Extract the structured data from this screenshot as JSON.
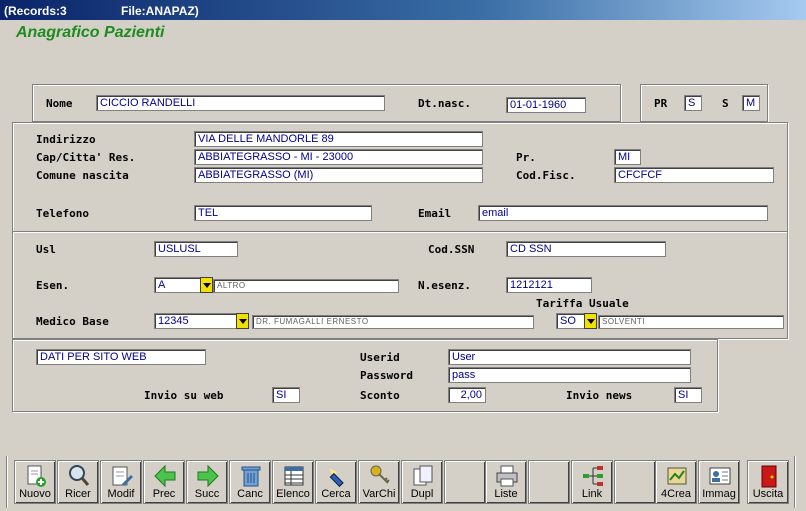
{
  "window": {
    "records": "(Records:3",
    "file": "File:ANAPAZ)"
  },
  "app_title": "Anagrafico Pazienti",
  "patient": {
    "nome_label": "Nome",
    "nome": "CICCIO RANDELLI",
    "dtnasc_label": "Dt.nasc.",
    "dtnasc": "01-01-1960",
    "pr_label": "PR",
    "pr": "S",
    "s_label": "S",
    "s": "M"
  },
  "address": {
    "indirizzo_label": "Indirizzo",
    "indirizzo": "VIA DELLE MANDORLE 89",
    "cap_label": "Cap/Citta' Res.",
    "cap": "ABBIATEGRASSO - MI - 23000",
    "prov_label": "Pr.",
    "prov": "MI",
    "comune_label": "Comune nascita",
    "comune": "ABBIATEGRASSO (MI)",
    "codfisc_label": "Cod.Fisc.",
    "codfisc": "CFCFCF",
    "telefono_label": "Telefono",
    "telefono": "TEL",
    "email_label": "Email",
    "email": "email"
  },
  "health": {
    "usl_label": "Usl",
    "usl": "USLUSL",
    "codssn_label": "Cod.SSN",
    "codssn": "CD SSN",
    "esen_label": "Esen.",
    "esen": "A",
    "esen_desc": "ALTRO",
    "nesenz_label": "N.esenz.",
    "nesenz": "1212121",
    "tariffa_label": "Tariffa Usuale",
    "medico_label": "Medico Base",
    "medico": "12345",
    "medico_desc": "DR. FUMAGALLI ERNESTO",
    "tariffa": "SO",
    "tariffa_desc": "SOLVENTI"
  },
  "web": {
    "dati": "DATI PER SITO WEB",
    "userid_label": "Userid",
    "userid": "User",
    "password_label": "Password",
    "password": "pass",
    "invio_web_label": "Invio su web",
    "invio_web": "SI",
    "sconto_label": "Sconto",
    "sconto": "2,00",
    "invio_news_label": "Invio news",
    "invio_news": "SI"
  },
  "toolbar": [
    {
      "label": "Nuovo",
      "icon": "new-document-icon"
    },
    {
      "label": "Ricer",
      "icon": "magnifier-icon"
    },
    {
      "label": "Modif",
      "icon": "edit-document-icon"
    },
    {
      "label": "Prec",
      "icon": "arrow-left-icon"
    },
    {
      "label": "Succ",
      "icon": "arrow-right-icon"
    },
    {
      "label": "Canc",
      "icon": "trash-icon"
    },
    {
      "label": "Elenco",
      "icon": "table-icon"
    },
    {
      "label": "Cerca",
      "icon": "flashlight-icon"
    },
    {
      "label": "VarChi",
      "icon": "keys-icon"
    },
    {
      "label": "Dupl",
      "icon": "duplicate-icon"
    },
    {
      "label": "",
      "icon": ""
    },
    {
      "label": "Liste",
      "icon": "printer-icon"
    },
    {
      "label": "",
      "icon": ""
    },
    {
      "label": "Link",
      "icon": "link-tree-icon"
    },
    {
      "label": "",
      "icon": ""
    },
    {
      "label": "4Crea",
      "icon": "create-icon"
    },
    {
      "label": "Immag",
      "icon": "id-card-icon"
    },
    {
      "label": "Uscita",
      "icon": "exit-door-icon"
    }
  ]
}
